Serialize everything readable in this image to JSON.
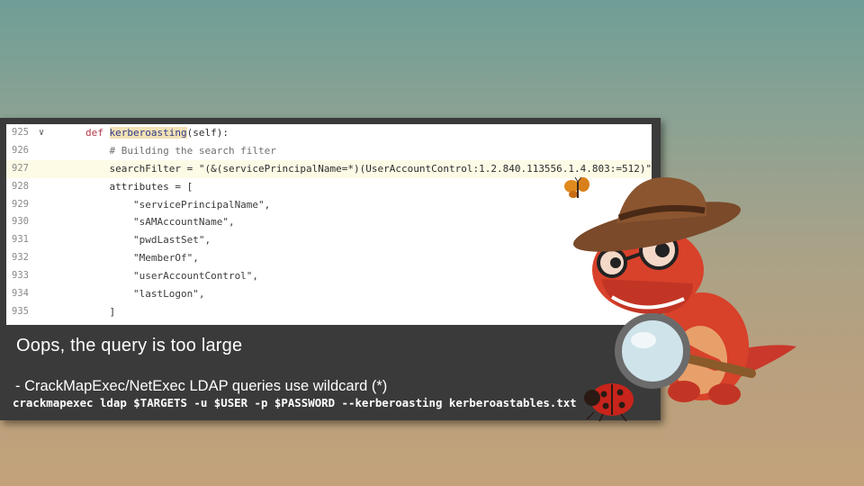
{
  "code": {
    "lines": [
      {
        "num": "925",
        "fold": "v",
        "parts": [
          {
            "t": "def ",
            "c": "kw"
          },
          {
            "t": "kerberoasting",
            "c": "fn"
          },
          {
            "t": "(self):",
            "c": ""
          }
        ]
      },
      {
        "num": "926",
        "fold": "",
        "parts": [
          {
            "t": "    # Building the search filter",
            "c": "cm"
          }
        ]
      },
      {
        "num": "927",
        "fold": "",
        "current": true,
        "parts": [
          {
            "t": "    searchFilter = \"(&(servicePrincipalName=*)(UserAccountControl:1.2.840.113556.1.4.803:=512)\"",
            "c": ""
          }
        ]
      },
      {
        "num": "928",
        "fold": "",
        "parts": [
          {
            "t": "    attributes = [",
            "c": ""
          }
        ]
      },
      {
        "num": "929",
        "fold": "",
        "parts": [
          {
            "t": "        \"servicePrincipalName\",",
            "c": "str"
          }
        ]
      },
      {
        "num": "930",
        "fold": "",
        "parts": [
          {
            "t": "        \"sAMAccountName\",",
            "c": "str"
          }
        ]
      },
      {
        "num": "931",
        "fold": "",
        "parts": [
          {
            "t": "        \"pwdLastSet\",",
            "c": "str"
          }
        ]
      },
      {
        "num": "932",
        "fold": "",
        "parts": [
          {
            "t": "        \"MemberOf\",",
            "c": "str"
          }
        ]
      },
      {
        "num": "933",
        "fold": "",
        "parts": [
          {
            "t": "        \"userAccountControl\",",
            "c": "str"
          }
        ]
      },
      {
        "num": "934",
        "fold": "",
        "parts": [
          {
            "t": "        \"lastLogon\",",
            "c": "str"
          }
        ]
      },
      {
        "num": "935",
        "fold": "",
        "parts": [
          {
            "t": "    ]",
            "c": ""
          }
        ]
      }
    ]
  },
  "slide": {
    "title": "Oops, the query is too large",
    "bullet": "- CrackMapExec/NetExec LDAP queries use wildcard (*)",
    "command": "crackmapexec ldap $TARGETS -u $USER -p $PASSWORD --kerberoasting kerberoastables.txt"
  },
  "illustration": {
    "mascot_icon": "detective-dinosaur-with-magnifying-glass-icon",
    "butterfly_icon": "butterfly-icon",
    "ladybug_icon": "ladybug-icon"
  },
  "colors": {
    "card_bg": "#3a3a3a",
    "keyword": "#b23a48",
    "function_highlight": "#f1e1b5",
    "dino_red": "#d8412a",
    "hat_brown": "#7a4a2a"
  }
}
